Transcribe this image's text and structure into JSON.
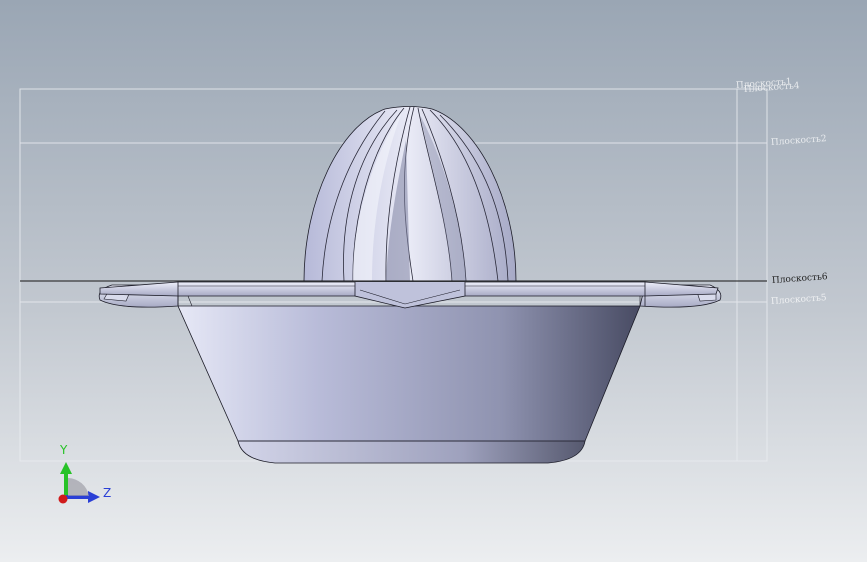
{
  "planes": {
    "plane4": "Плоскость4",
    "plane1": "Плоскость1",
    "plane2": "Плоскость2",
    "plane6": "Плоскость6",
    "plane5": "Плоскость5"
  },
  "triad": {
    "y_label": "Y",
    "z_label": "Z",
    "y_color": "#27c227",
    "z_color": "#2a3fd6",
    "x_color": "#d01b1b"
  },
  "colors": {
    "body_light": "#c7cbe4",
    "body_dark": "#50536d",
    "edge": "#1c1c28",
    "plane_line": "#e9ecf0"
  }
}
